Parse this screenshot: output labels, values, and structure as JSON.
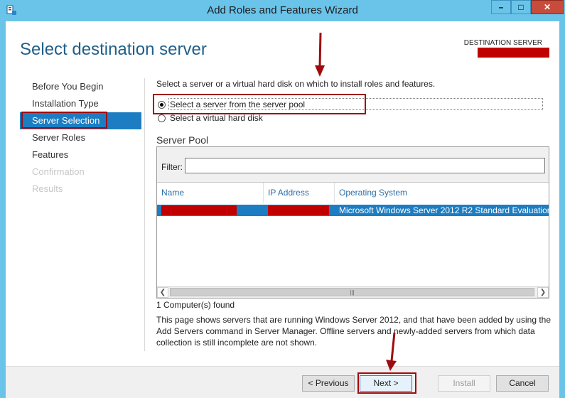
{
  "window": {
    "title": "Add Roles and Features Wizard",
    "controls": {
      "minimize": "–",
      "maximize": "□",
      "close": "✕"
    }
  },
  "header": {
    "heading": "Select destination server",
    "destination_label": "DESTINATION SERVER"
  },
  "nav": {
    "items": [
      {
        "label": "Before You Begin",
        "state": "normal"
      },
      {
        "label": "Installation Type",
        "state": "normal"
      },
      {
        "label": "Server Selection",
        "state": "active"
      },
      {
        "label": "Server Roles",
        "state": "normal"
      },
      {
        "label": "Features",
        "state": "normal"
      },
      {
        "label": "Confirmation",
        "state": "disabled"
      },
      {
        "label": "Results",
        "state": "disabled"
      }
    ]
  },
  "main": {
    "intro": "Select a server or a virtual hard disk on which to install roles and features.",
    "options": [
      {
        "label": "Select a server from the server pool",
        "selected": true
      },
      {
        "label": "Select a virtual hard disk",
        "selected": false
      }
    ],
    "pool": {
      "title": "Server Pool",
      "filter_label": "Filter:",
      "filter_value": "",
      "columns": [
        "Name",
        "IP Address",
        "Operating System"
      ],
      "rows": [
        {
          "name": "",
          "ip": "",
          "os": "Microsoft Windows Server 2012 R2 Standard Evaluation"
        }
      ],
      "count_text": "1 Computer(s) found"
    },
    "description": "This page shows servers that are running Windows Server 2012, and that have been added by using the Add Servers command in Server Manager. Offline servers and newly-added servers from which data collection is still incomplete are not shown."
  },
  "footer": {
    "previous": "< Previous",
    "next": "Next >",
    "install": "Install",
    "cancel": "Cancel"
  },
  "colors": {
    "accent": "#1c7dc2",
    "heading": "#1f5f8b",
    "annotation": "#9e0b0f",
    "redaction": "#c00000",
    "frame": "#6ac4ea"
  }
}
